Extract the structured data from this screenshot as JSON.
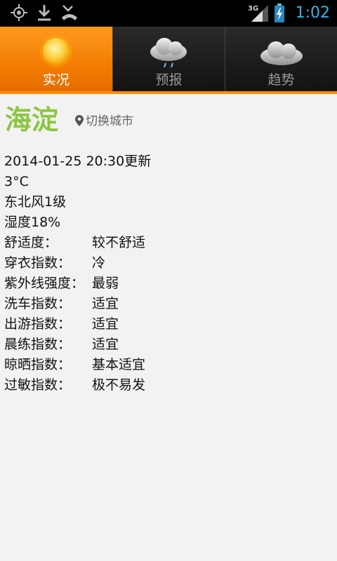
{
  "status_bar": {
    "time": "1:02",
    "network": "3G",
    "icons": [
      "gps-icon",
      "download-icon",
      "missed-call-icon",
      "signal-icon",
      "battery-icon"
    ]
  },
  "tabs": [
    {
      "label": "实况",
      "icon": "sun-icon",
      "active": true
    },
    {
      "label": "预报",
      "icon": "rain-cloud-icon",
      "active": false
    },
    {
      "label": "趋势",
      "icon": "cloud-icon",
      "active": false
    }
  ],
  "city": {
    "name": "海淀",
    "switch_label": "切换城市"
  },
  "weather": {
    "updated": "2014-01-25 20:30更新",
    "temperature": "3°C",
    "wind": "东北风1级",
    "humidity": "湿度18%"
  },
  "indices": [
    {
      "label": "舒适度：",
      "value": "较不舒适"
    },
    {
      "label": "穿衣指数：",
      "value": "冷"
    },
    {
      "label": "紫外线强度：",
      "value": "最弱"
    },
    {
      "label": "洗车指数：",
      "value": "适宜"
    },
    {
      "label": "出游指数：",
      "value": "适宜"
    },
    {
      "label": "晨练指数：",
      "value": "适宜"
    },
    {
      "label": "晾晒指数：",
      "value": "基本适宜"
    },
    {
      "label": "过敏指数：",
      "value": "极不易发"
    }
  ],
  "colors": {
    "accent": "#ff8a00",
    "city": "#8cc63f",
    "clock": "#33b5e5"
  }
}
